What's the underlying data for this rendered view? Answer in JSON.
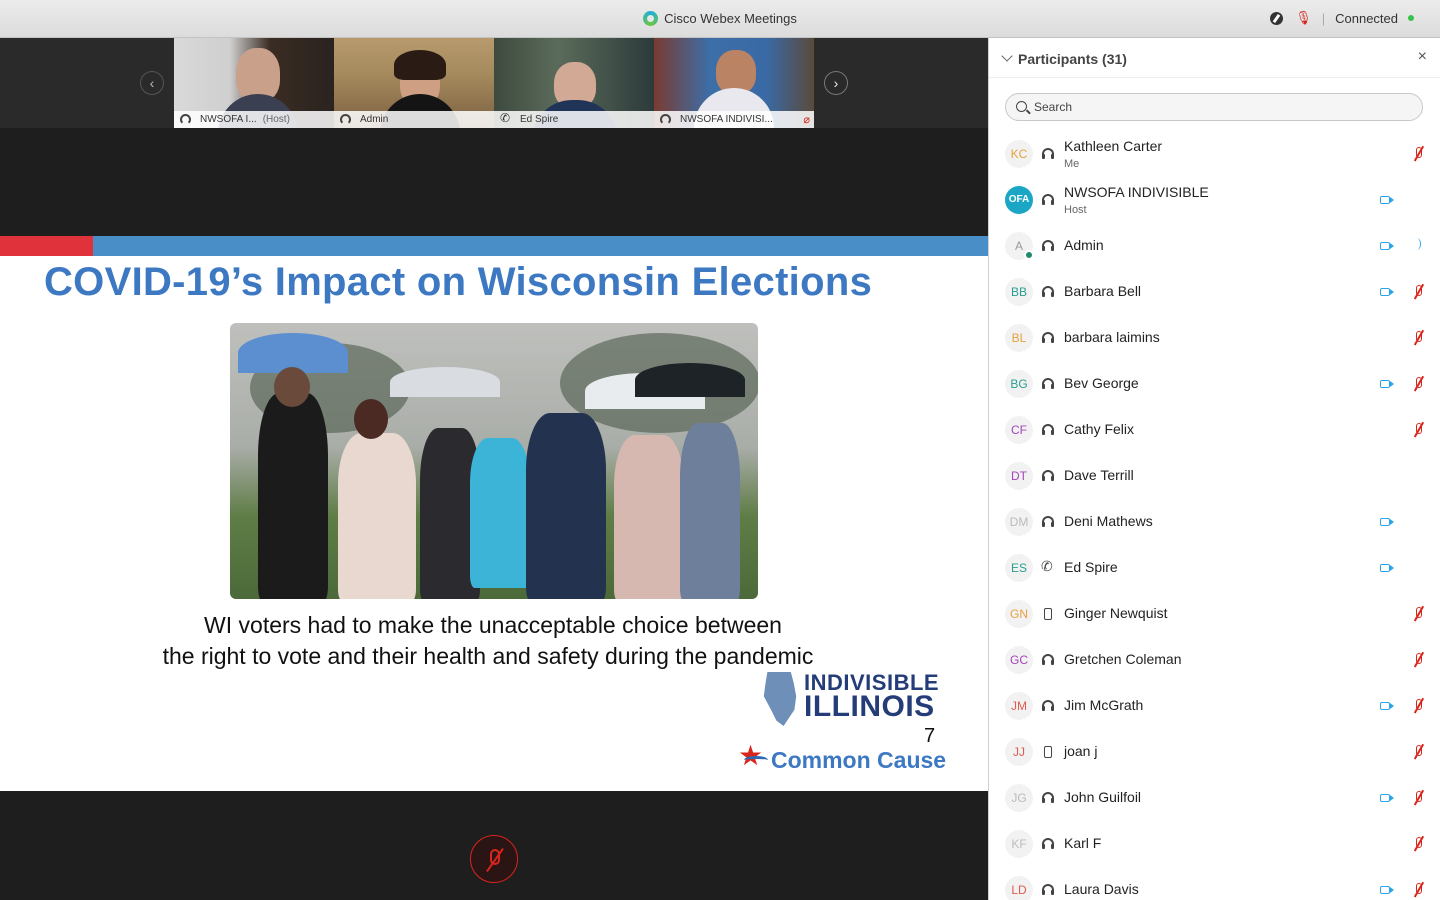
{
  "window": {
    "title": "Cisco Webex Meetings",
    "status": "Connected",
    "separator": "|"
  },
  "thumbnails": [
    {
      "name": "NWSOFA I...",
      "tag": "(Host)",
      "active": false,
      "muted": false
    },
    {
      "name": "Admin",
      "tag": "",
      "active": true,
      "muted": false
    },
    {
      "name": "Ed Spire",
      "tag": "",
      "active": false,
      "muted": false
    },
    {
      "name": "NWSOFA INDIVISI...",
      "tag": "",
      "active": false,
      "muted": true
    }
  ],
  "nav": {
    "prev": "‹",
    "next": "›"
  },
  "slide": {
    "title": "COVID-19’s Impact on Wisconsin Elections",
    "caption_line1": "WI voters had to make the unacceptable choice between",
    "caption_line2": "the right to vote and their health and safety during the pandemic",
    "logo_line1": "INDIVISIBLE",
    "logo_line2": "ILLINOIS",
    "page_number": "7",
    "logo_common_cause": "Common Cause",
    "colors": {
      "title": "#3d78c2",
      "bar_red": "#e0323a",
      "bar_blue": "#4a8ec8"
    }
  },
  "panel": {
    "title": "Participants (31)",
    "close": "×",
    "search_placeholder": "Search"
  },
  "participants": [
    {
      "initials": "KC",
      "name": "Kathleen Carter",
      "sub": "Me",
      "audio": "headset",
      "video": false,
      "muted": true,
      "color": "#e6a23c"
    },
    {
      "initials": "OFA",
      "name": "NWSOFA INDIVISIBLE",
      "sub": "Host",
      "audio": "headset",
      "video": true,
      "muted": false,
      "color": "#1aa6c4"
    },
    {
      "initials": "A",
      "name": "Admin",
      "sub": "",
      "audio": "headset",
      "video": true,
      "muted": false,
      "speaking": true,
      "color": "#999999"
    },
    {
      "initials": "BB",
      "name": "Barbara Bell",
      "sub": "",
      "audio": "headset",
      "video": true,
      "muted": true,
      "color": "#2a9d8f"
    },
    {
      "initials": "BL",
      "name": "barbara laimins",
      "sub": "",
      "audio": "headset",
      "video": false,
      "muted": true,
      "color": "#e6a23c"
    },
    {
      "initials": "BG",
      "name": "Bev George",
      "sub": "",
      "audio": "headset",
      "video": true,
      "muted": true,
      "color": "#2a9d8f"
    },
    {
      "initials": "CF",
      "name": "Cathy Felix",
      "sub": "",
      "audio": "headset",
      "video": false,
      "muted": true,
      "color": "#a347b8"
    },
    {
      "initials": "DT",
      "name": "Dave Terrill",
      "sub": "",
      "audio": "headset",
      "video": false,
      "muted": false,
      "color": "#a347b8"
    },
    {
      "initials": "DM",
      "name": "Deni Mathews",
      "sub": "",
      "audio": "headset",
      "video": true,
      "muted": false,
      "color": "#bbbbbb"
    },
    {
      "initials": "ES",
      "name": "Ed Spire",
      "sub": "",
      "audio": "phone",
      "video": true,
      "muted": false,
      "color": "#2a9d8f"
    },
    {
      "initials": "GN",
      "name": "Ginger Newquist",
      "sub": "",
      "audio": "mobile",
      "video": false,
      "muted": true,
      "color": "#e6a23c"
    },
    {
      "initials": "GC",
      "name": "Gretchen Coleman",
      "sub": "",
      "audio": "headset",
      "video": false,
      "muted": true,
      "color": "#a347b8"
    },
    {
      "initials": "JM",
      "name": "Jim McGrath",
      "sub": "",
      "audio": "headset",
      "video": true,
      "muted": true,
      "color": "#e05a4e"
    },
    {
      "initials": "JJ",
      "name": "joan j",
      "sub": "",
      "audio": "mobile",
      "video": false,
      "muted": true,
      "color": "#e05a4e"
    },
    {
      "initials": "JG",
      "name": "John Guilfoil",
      "sub": "",
      "audio": "headset",
      "video": true,
      "muted": true,
      "color": "#bbbbbb"
    },
    {
      "initials": "KF",
      "name": "Karl F",
      "sub": "",
      "audio": "headset",
      "video": false,
      "muted": true,
      "color": "#bbbbbb"
    },
    {
      "initials": "LD",
      "name": "Laura Davis",
      "sub": "",
      "audio": "headset",
      "video": true,
      "muted": true,
      "color": "#e05a4e"
    }
  ]
}
